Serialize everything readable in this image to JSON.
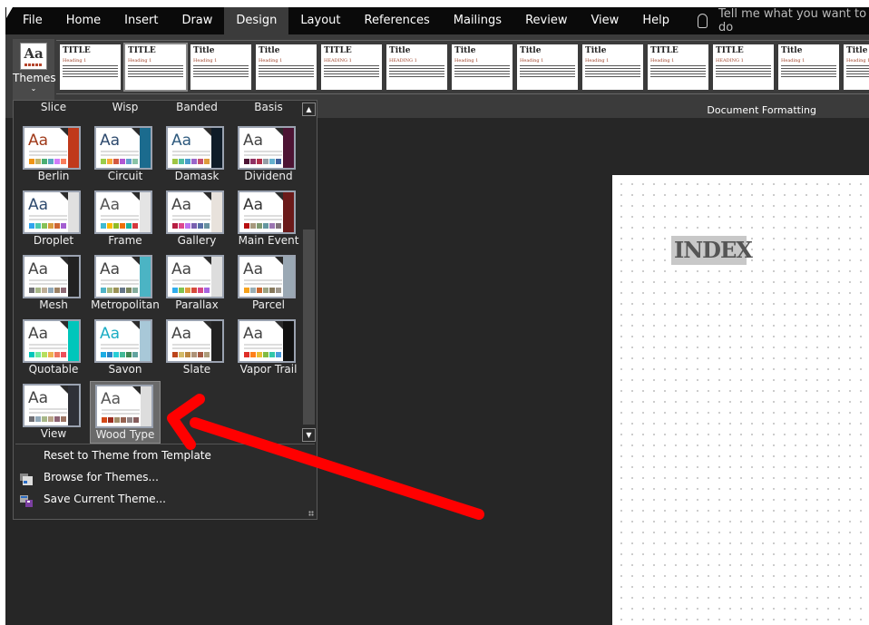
{
  "tabs": [
    {
      "label": "File"
    },
    {
      "label": "Home"
    },
    {
      "label": "Insert"
    },
    {
      "label": "Draw"
    },
    {
      "label": "Design",
      "active": true
    },
    {
      "label": "Layout"
    },
    {
      "label": "References"
    },
    {
      "label": "Mailings"
    },
    {
      "label": "Review"
    },
    {
      "label": "View"
    },
    {
      "label": "Help"
    }
  ],
  "tell_me": "Tell me what you want to do",
  "ribbon": {
    "themes_label": "Themes",
    "themes_icon_text": "Aa",
    "group_label": "Document Formatting",
    "style_sets": [
      {
        "title": "TITLE",
        "heading": "Heading 1"
      },
      {
        "title": "TITLE",
        "heading": "Heading 1",
        "selected": true
      },
      {
        "title": "Title",
        "heading": "Heading 1"
      },
      {
        "title": "Title",
        "heading": "Heading 1"
      },
      {
        "title": "TITLE",
        "heading": "HEADING 1"
      },
      {
        "title": "Title",
        "heading": "HEADING 1"
      },
      {
        "title": "Title",
        "heading": "Heading 1"
      },
      {
        "title": "Title",
        "heading": "Heading 1"
      },
      {
        "title": "Title",
        "heading": "Heading 1"
      },
      {
        "title": "TITLE",
        "heading": "Heading 1"
      },
      {
        "title": "TITLE",
        "heading": "HEADING 1"
      },
      {
        "title": "Title",
        "heading": "Heading 1"
      },
      {
        "title": "Title",
        "heading": "Heading 1"
      }
    ]
  },
  "document": {
    "text": "INDEX"
  },
  "gallery": {
    "partial_row": [
      "Slice",
      "Wisp",
      "Banded",
      "Basis"
    ],
    "themes": [
      {
        "name": "Berlin",
        "aa": "#a03a1a",
        "accent": "#c0391b",
        "colors": [
          "#f09415",
          "#c1b56b",
          "#4baf73",
          "#5aa6c0",
          "#d17df9",
          "#fa7e5c"
        ]
      },
      {
        "name": "Circuit",
        "aa": "#2e4a6e",
        "accent": "#1b6b8e",
        "colors": [
          "#9acd4c",
          "#faa93a",
          "#d35940",
          "#b258d3",
          "#63a0cc",
          "#8ac4a7"
        ]
      },
      {
        "name": "Damask",
        "aa": "#2e5a7e",
        "accent": "#0f1c28",
        "colors": [
          "#9ec544",
          "#50bea3",
          "#4a9ccc",
          "#9a66ca",
          "#c54f71",
          "#de9c3c"
        ]
      },
      {
        "name": "Dividend",
        "aa": "#444",
        "accent": "#4d1434",
        "colors": [
          "#4d1434",
          "#903163",
          "#b2324b",
          "#969fa7",
          "#66b1ce",
          "#40619d"
        ]
      },
      {
        "name": "Droplet",
        "aa": "#2e4a6e",
        "accent": "#e0e0e0",
        "colors": [
          "#2fa3ee",
          "#4bcaad",
          "#86c157",
          "#d99c3f",
          "#ce6633",
          "#a35dd1"
        ]
      },
      {
        "name": "Frame",
        "aa": "#555",
        "accent": "#e4e4e4",
        "colors": [
          "#40bad2",
          "#fab900",
          "#90bb23",
          "#ee7008",
          "#1ab39f",
          "#d5393d"
        ]
      },
      {
        "name": "Gallery",
        "aa": "#444",
        "accent": "#e8e2dc",
        "colors": [
          "#b71e42",
          "#de478e",
          "#bc72f0",
          "#795faf",
          "#586ea6",
          "#6892a0"
        ]
      },
      {
        "name": "Main Event",
        "aa": "#333",
        "accent": "#6b1a1a",
        "colors": [
          "#b80e0f",
          "#a6987d",
          "#7f9a71",
          "#64969f",
          "#9b75b2",
          "#80737a"
        ]
      },
      {
        "name": "Mesh",
        "aa": "#444",
        "accent": "#222",
        "colors": [
          "#6f6f74",
          "#a7b789",
          "#beae98",
          "#92a9b9",
          "#9c8265",
          "#8d6974"
        ]
      },
      {
        "name": "Metropolitan",
        "aa": "#444",
        "accent": "#4bb4c4",
        "colors": [
          "#50b4c8",
          "#a8b97f",
          "#9b9256",
          "#657689",
          "#7a855d",
          "#84ac9d"
        ]
      },
      {
        "name": "Parallax",
        "aa": "#444",
        "accent": "#ddd",
        "colors": [
          "#30acec",
          "#80c34f",
          "#e29d3e",
          "#d64a3b",
          "#d64787",
          "#a666e1"
        ]
      },
      {
        "name": "Parcel",
        "aa": "#444",
        "accent": "#9aa8b4",
        "colors": [
          "#f6a21d",
          "#9bafb5",
          "#c96731",
          "#9ca383",
          "#87795d",
          "#a0988c"
        ]
      },
      {
        "name": "Quotable",
        "aa": "#444",
        "accent": "#00c6bb",
        "colors": [
          "#00c6bb",
          "#6feba0",
          "#b6df5e",
          "#efb251",
          "#ef755f",
          "#ed515c"
        ]
      },
      {
        "name": "Savon",
        "aa": "#1cadc4",
        "accent": "#a8c8d8",
        "colors": [
          "#1cade4",
          "#2683c6",
          "#27ced7",
          "#42ba97",
          "#3e8853",
          "#62a39f"
        ]
      },
      {
        "name": "Slate",
        "aa": "#444",
        "accent": "#222",
        "colors": [
          "#bc451b",
          "#d3ba68",
          "#bb8640",
          "#ad9277",
          "#a55a43",
          "#ad9d7b"
        ]
      },
      {
        "name": "Vapor Trail",
        "aa": "#444",
        "accent": "#111",
        "colors": [
          "#df2e28",
          "#fe801a",
          "#e9bf35",
          "#81bb42",
          "#32c7a9",
          "#4a9bdc"
        ]
      },
      {
        "name": "View",
        "aa": "#444",
        "accent": "#2f3138",
        "colors": [
          "#6f6f74",
          "#92a9b9",
          "#a7b789",
          "#b9a489",
          "#8d6374",
          "#9b7362"
        ]
      },
      {
        "name": "Wood Type",
        "aa": "#555",
        "accent": "#ddd",
        "colors": [
          "#d34817",
          "#9b2d1f",
          "#a28e6a",
          "#956251",
          "#918485",
          "#855d5d"
        ],
        "selected": true
      }
    ],
    "menu": [
      {
        "label": "Reset to Theme from Template",
        "icon": "none"
      },
      {
        "label": "Browse for Themes...",
        "icon": "browse-icon"
      },
      {
        "label": "Save Current Theme...",
        "icon": "save-theme-icon"
      }
    ]
  },
  "annotation": {
    "arrow_color": "#ff0000"
  }
}
